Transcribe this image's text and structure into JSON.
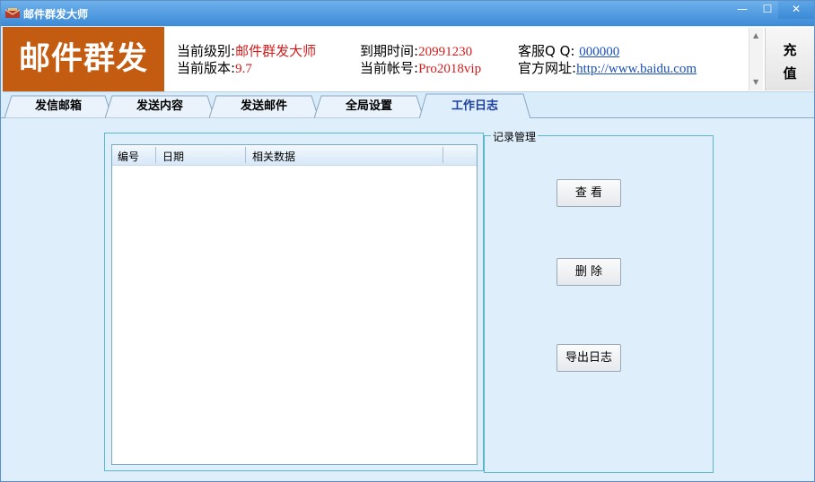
{
  "window": {
    "title": "邮件群发大师",
    "minimize": "—",
    "maximize": "☐",
    "close": "✕"
  },
  "header": {
    "logo": "邮件群发",
    "level_label": "当前级别:",
    "level_value": "邮件群发大师",
    "version_label": "当前版本:",
    "version_value": "9.7",
    "expire_label": "到期时间:",
    "expire_value": "20991230",
    "account_label": "当前帐号:",
    "account_value": "Pro2018vip",
    "qq_label": "客服Q Q: ",
    "qq_value": "000000",
    "site_label": "官方网址:",
    "site_value": "http://www.baidu.com",
    "recharge_1": "充",
    "recharge_2": "值"
  },
  "tabs": [
    {
      "label": "发信邮箱",
      "active": false
    },
    {
      "label": "发送内容",
      "active": false
    },
    {
      "label": "发送邮件",
      "active": false
    },
    {
      "label": "全局设置",
      "active": false
    },
    {
      "label": "工作日志",
      "active": true
    }
  ],
  "log_table": {
    "columns": [
      "编号",
      "日期",
      "相关数据"
    ],
    "rows": []
  },
  "record_group": {
    "title": "记录管理",
    "view_button": "查 看",
    "delete_button": "删 除",
    "export_button": "导出日志"
  },
  "colors": {
    "logo_bg": "#c35b11",
    "value_red": "#d21c1c",
    "link_blue": "#1a4fb5",
    "titlebar": "#3c8ad6"
  }
}
